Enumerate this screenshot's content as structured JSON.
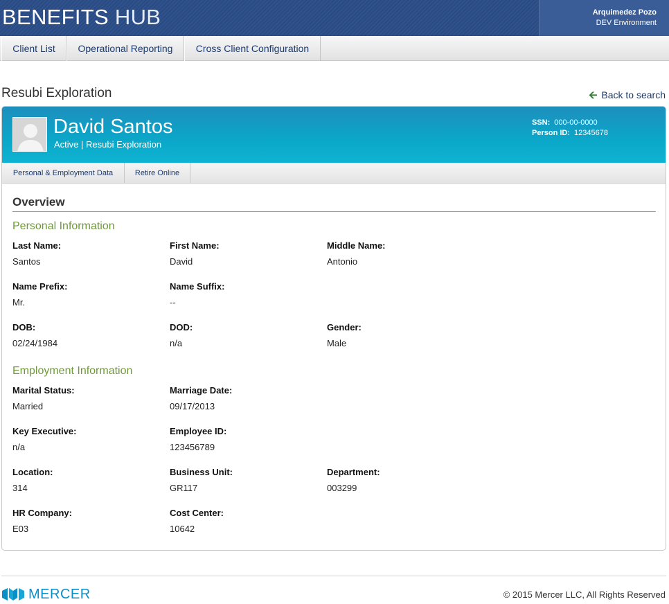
{
  "header": {
    "brand_part1": "BENEFITS",
    "brand_part2": "HUB",
    "user_name": "Arquimedez Pozo",
    "environment": "DEV Environment"
  },
  "nav": {
    "items": [
      {
        "label": "Client List"
      },
      {
        "label": "Operational Reporting"
      },
      {
        "label": "Cross Client Configuration"
      }
    ]
  },
  "page": {
    "title": "Resubi Exploration",
    "back_label": "Back to search"
  },
  "person": {
    "name": "David Santos",
    "status_line": "Active | Resubi Exploration",
    "ssn_label": "SSN:",
    "ssn_value": "000-00-0000",
    "person_id_label": "Person ID:",
    "person_id_value": "12345678"
  },
  "tabs": [
    {
      "label": "Personal & Employment Data"
    },
    {
      "label": "Retire Online"
    }
  ],
  "overview": {
    "title": "Overview",
    "personal_title": "Personal Information",
    "employment_title": "Employment Information",
    "personal_fields": [
      {
        "label": "Last Name:",
        "value": "Santos"
      },
      {
        "label": "First Name:",
        "value": "David"
      },
      {
        "label": "Middle Name:",
        "value": "Antonio"
      },
      {
        "label": "Name Prefix:",
        "value": "Mr."
      },
      {
        "label": "Name Suffix:",
        "value": "--"
      },
      {
        "label": "DOB:",
        "value": "02/24/1984"
      },
      {
        "label": "DOD:",
        "value": "n/a"
      },
      {
        "label": "Gender:",
        "value": "Male"
      }
    ],
    "employment_fields": [
      {
        "label": "Marital Status:",
        "value": "Married"
      },
      {
        "label": "Marriage Date:",
        "value": "09/17/2013"
      },
      {
        "label": "Key Executive:",
        "value": "n/a"
      },
      {
        "label": "Employee ID:",
        "value": "123456789"
      },
      {
        "label": "Location:",
        "value": "314"
      },
      {
        "label": "Business Unit:",
        "value": "GR117"
      },
      {
        "label": "Department:",
        "value": "003299"
      },
      {
        "label": "HR Company:",
        "value": "E03"
      },
      {
        "label": "Cost Center:",
        "value": "10642"
      }
    ]
  },
  "footer": {
    "logo_text": "MERCER",
    "copyright": "© 2015 Mercer LLC, All Rights Reserved"
  },
  "colors": {
    "header_bg": "#2a4a82",
    "banner": "#0aa7c9",
    "section_green": "#6f9a3a",
    "link": "#1b3a6e",
    "mercer_blue": "#0b8fc7"
  }
}
